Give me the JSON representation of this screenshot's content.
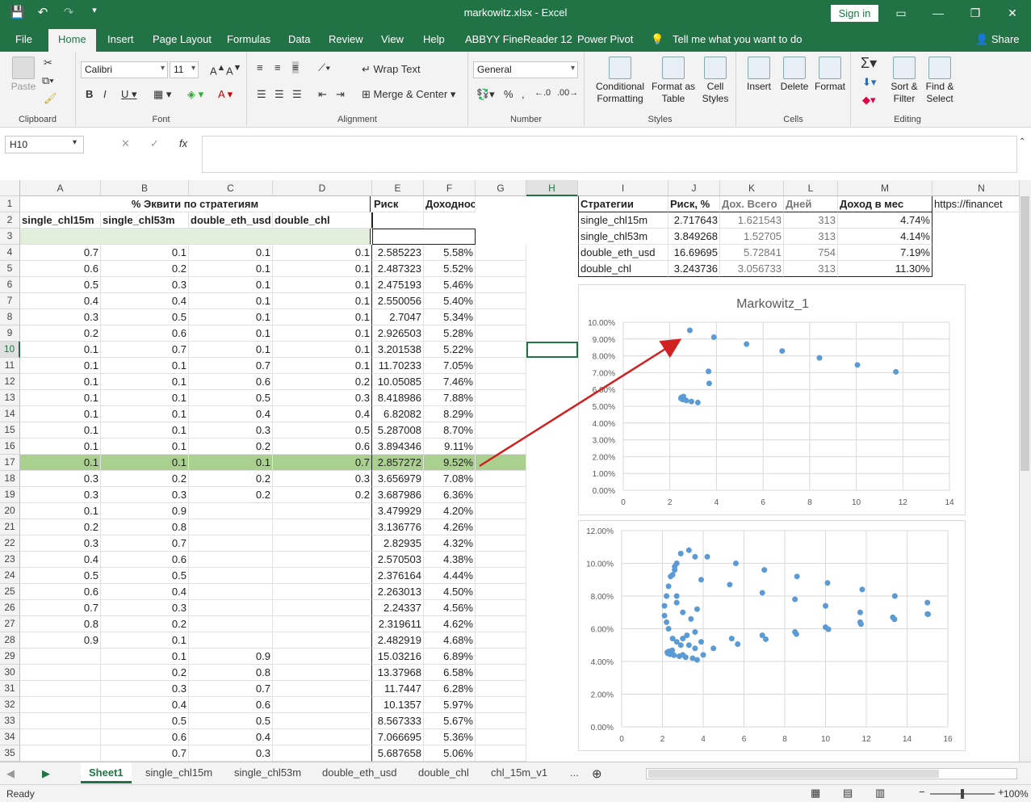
{
  "title_bar": {
    "title": "markowitz.xlsx - Excel",
    "sign_in": "Sign in"
  },
  "menu_tabs": [
    "File",
    "Home",
    "Insert",
    "Page Layout",
    "Formulas",
    "Data",
    "Review",
    "View",
    "Help",
    "ABBYY FineReader 12",
    "Power Pivot",
    "Tell me what you want to do",
    "Share"
  ],
  "ribbon": {
    "clipboard": {
      "label": "Clipboard",
      "paste": "Paste"
    },
    "font": {
      "label": "Font",
      "name": "Calibri",
      "size": "11"
    },
    "alignment": {
      "label": "Alignment",
      "wrap": "Wrap Text",
      "merge": "Merge & Center"
    },
    "number": {
      "label": "Number",
      "format": "General"
    },
    "styles": {
      "label": "Styles",
      "cond": "Conditional\nFormatting",
      "table": "Format as\nTable",
      "cell": "Cell\nStyles"
    },
    "cells": {
      "label": "Cells",
      "insert": "Insert",
      "delete": "Delete",
      "format": "Format"
    },
    "editing": {
      "label": "Editing",
      "sort": "Sort &\nFilter",
      "find": "Find &\nSelect"
    }
  },
  "formula_bar": {
    "name_box": "H10",
    "formula": ""
  },
  "columns": [
    "A",
    "B",
    "C",
    "D",
    "E",
    "F",
    "G",
    "H",
    "I",
    "J",
    "K",
    "L",
    "M",
    "N"
  ],
  "header_row1": {
    "equity": "% Эквити по стратегиям",
    "risk": "Риск",
    "return": "Доходность"
  },
  "header_row2": [
    "single_chl15m",
    "single_chl53m",
    "double_eth_usd",
    "double_chl"
  ],
  "rows": [
    [
      "0.7",
      "0.1",
      "0.1",
      "0.1",
      "2.585223",
      "5.58%"
    ],
    [
      "0.6",
      "0.2",
      "0.1",
      "0.1",
      "2.487323",
      "5.52%"
    ],
    [
      "0.5",
      "0.3",
      "0.1",
      "0.1",
      "2.475193",
      "5.46%"
    ],
    [
      "0.4",
      "0.4",
      "0.1",
      "0.1",
      "2.550056",
      "5.40%"
    ],
    [
      "0.3",
      "0.5",
      "0.1",
      "0.1",
      "2.7047",
      "5.34%"
    ],
    [
      "0.2",
      "0.6",
      "0.1",
      "0.1",
      "2.926503",
      "5.28%"
    ],
    [
      "0.1",
      "0.7",
      "0.1",
      "0.1",
      "3.201538",
      "5.22%"
    ],
    [
      "0.1",
      "0.1",
      "0.7",
      "0.1",
      "11.70233",
      "7.05%"
    ],
    [
      "0.1",
      "0.1",
      "0.6",
      "0.2",
      "10.05085",
      "7.46%"
    ],
    [
      "0.1",
      "0.1",
      "0.5",
      "0.3",
      "8.418986",
      "7.88%"
    ],
    [
      "0.1",
      "0.1",
      "0.4",
      "0.4",
      "6.82082",
      "8.29%"
    ],
    [
      "0.1",
      "0.1",
      "0.3",
      "0.5",
      "5.287008",
      "8.70%"
    ],
    [
      "0.1",
      "0.1",
      "0.2",
      "0.6",
      "3.894346",
      "9.11%"
    ],
    [
      "0.1",
      "0.1",
      "0.1",
      "0.7",
      "2.857272",
      "9.52%"
    ],
    [
      "0.3",
      "0.2",
      "0.2",
      "0.3",
      "3.656979",
      "7.08%"
    ],
    [
      "0.3",
      "0.3",
      "0.2",
      "0.2",
      "3.687986",
      "6.36%"
    ],
    [
      "0.1",
      "0.9",
      "",
      "",
      "3.479929",
      "4.20%"
    ],
    [
      "0.2",
      "0.8",
      "",
      "",
      "3.136776",
      "4.26%"
    ],
    [
      "0.3",
      "0.7",
      "",
      "",
      "2.82935",
      "4.32%"
    ],
    [
      "0.4",
      "0.6",
      "",
      "",
      "2.570503",
      "4.38%"
    ],
    [
      "0.5",
      "0.5",
      "",
      "",
      "2.376164",
      "4.44%"
    ],
    [
      "0.6",
      "0.4",
      "",
      "",
      "2.263013",
      "4.50%"
    ],
    [
      "0.7",
      "0.3",
      "",
      "",
      "2.24337",
      "4.56%"
    ],
    [
      "0.8",
      "0.2",
      "",
      "",
      "2.319611",
      "4.62%"
    ],
    [
      "0.9",
      "0.1",
      "",
      "",
      "2.482919",
      "4.68%"
    ],
    [
      "",
      "0.1",
      "0.9",
      "",
      "15.03216",
      "6.89%"
    ],
    [
      "",
      "0.2",
      "0.8",
      "",
      "13.37968",
      "6.58%"
    ],
    [
      "",
      "0.3",
      "0.7",
      "",
      "11.7447",
      "6.28%"
    ],
    [
      "",
      "0.4",
      "0.6",
      "",
      "10.1357",
      "5.97%"
    ],
    [
      "",
      "0.5",
      "0.5",
      "",
      "8.567333",
      "5.67%"
    ],
    [
      "",
      "0.6",
      "0.4",
      "",
      "7.066695",
      "5.36%"
    ],
    [
      "",
      "0.7",
      "0.3",
      "",
      "5.687658",
      "5.06%"
    ]
  ],
  "strategy_table": {
    "headers": [
      "Стратегии",
      "Риск, %",
      "Дох. Всего",
      "Дней",
      "Доход в мес"
    ],
    "rows": [
      [
        "single_chl15m",
        "2.717643",
        "1.621543",
        "313",
        "4.74%"
      ],
      [
        "single_chl53m",
        "3.849268",
        "1.52705",
        "313",
        "4.14%"
      ],
      [
        "double_eth_usd",
        "16.69695",
        "5.72841",
        "754",
        "7.19%"
      ],
      [
        "double_chl",
        "3.243736",
        "3.056733",
        "313",
        "11.30%"
      ]
    ],
    "link": "https://financet"
  },
  "chart_data": [
    {
      "type": "scatter",
      "title": "Markowitz_1",
      "xlim": [
        0,
        14
      ],
      "ylim": [
        0,
        0.1
      ],
      "x_ticks": [
        "0",
        "2",
        "4",
        "6",
        "8",
        "10",
        "12",
        "14"
      ],
      "y_ticks": [
        "0.00%",
        "1.00%",
        "2.00%",
        "3.00%",
        "4.00%",
        "5.00%",
        "6.00%",
        "7.00%",
        "8.00%",
        "9.00%",
        "10.00%"
      ],
      "points": [
        [
          2.585,
          5.58
        ],
        [
          2.487,
          5.52
        ],
        [
          2.475,
          5.46
        ],
        [
          2.55,
          5.4
        ],
        [
          2.705,
          5.34
        ],
        [
          2.927,
          5.28
        ],
        [
          3.2,
          5.22
        ],
        [
          11.7,
          7.05
        ],
        [
          10.05,
          7.46
        ],
        [
          8.42,
          7.88
        ],
        [
          6.82,
          8.29
        ],
        [
          5.29,
          8.7
        ],
        [
          3.89,
          9.11
        ],
        [
          2.857,
          9.52
        ],
        [
          3.657,
          7.08
        ],
        [
          3.688,
          6.36
        ]
      ]
    },
    {
      "type": "scatter",
      "title": "",
      "xlim": [
        0,
        16
      ],
      "ylim": [
        0,
        12
      ],
      "x_ticks": [
        "0",
        "2",
        "4",
        "6",
        "8",
        "10",
        "12",
        "14",
        "16"
      ],
      "y_ticks": [
        "0.00%",
        "2.00%",
        "4.00%",
        "6.00%",
        "8.00%",
        "10.00%",
        "12.00%"
      ],
      "points": [
        [
          3.48,
          4.2
        ],
        [
          3.14,
          4.26
        ],
        [
          2.83,
          4.32
        ],
        [
          2.57,
          4.38
        ],
        [
          2.38,
          4.44
        ],
        [
          2.26,
          4.5
        ],
        [
          2.24,
          4.56
        ],
        [
          2.32,
          4.62
        ],
        [
          2.48,
          4.68
        ],
        [
          15.03,
          6.89
        ],
        [
          13.38,
          6.58
        ],
        [
          11.74,
          6.28
        ],
        [
          10.14,
          5.97
        ],
        [
          8.57,
          5.67
        ],
        [
          7.07,
          5.36
        ],
        [
          5.69,
          5.06
        ],
        [
          15.0,
          7.6
        ],
        [
          13.4,
          8.0
        ],
        [
          11.8,
          8.4
        ],
        [
          10.1,
          8.8
        ],
        [
          8.6,
          9.2
        ],
        [
          7.0,
          9.6
        ],
        [
          5.6,
          10.0
        ],
        [
          4.2,
          10.4
        ],
        [
          3.3,
          10.8
        ],
        [
          2.9,
          10.6
        ],
        [
          2.7,
          10.0
        ],
        [
          2.6,
          9.8
        ],
        [
          2.5,
          9.3
        ],
        [
          2.4,
          9.2
        ],
        [
          2.3,
          8.6
        ],
        [
          2.2,
          8.0
        ],
        [
          2.1,
          7.4
        ],
        [
          2.1,
          6.8
        ],
        [
          2.2,
          6.4
        ],
        [
          2.3,
          6.0
        ],
        [
          2.5,
          5.4
        ],
        [
          2.7,
          5.2
        ],
        [
          3.0,
          5.4
        ],
        [
          3.2,
          5.6
        ],
        [
          3.6,
          5.8
        ],
        [
          3.9,
          5.2
        ],
        [
          4.5,
          4.8
        ],
        [
          4.0,
          4.4
        ],
        [
          3.6,
          4.8
        ],
        [
          3.3,
          5.0
        ],
        [
          2.9,
          5.0
        ],
        [
          2.7,
          7.6
        ],
        [
          3.0,
          7.0
        ],
        [
          3.4,
          6.6
        ],
        [
          3.7,
          7.2
        ],
        [
          3.9,
          9.0
        ],
        [
          3.6,
          10.4
        ],
        [
          2.7,
          8.0
        ],
        [
          5.3,
          8.7
        ],
        [
          5.4,
          5.4
        ],
        [
          6.9,
          8.2
        ],
        [
          6.9,
          5.6
        ],
        [
          8.5,
          7.8
        ],
        [
          8.5,
          5.8
        ],
        [
          10.0,
          7.4
        ],
        [
          10.0,
          6.1
        ],
        [
          11.7,
          7.0
        ],
        [
          11.7,
          6.4
        ],
        [
          13.3,
          6.7
        ],
        [
          15.0,
          6.9
        ],
        [
          2.6,
          9.6
        ],
        [
          3.0,
          4.4
        ],
        [
          2.3,
          4.5
        ],
        [
          3.7,
          4.1
        ]
      ]
    }
  ],
  "sheet_tabs": [
    "Sheet1",
    "single_chl15m",
    "single_chl53m",
    "double_eth_usd",
    "double_chl",
    "chl_15m_v1",
    "..."
  ],
  "status": {
    "ready": "Ready",
    "zoom": "100%"
  }
}
